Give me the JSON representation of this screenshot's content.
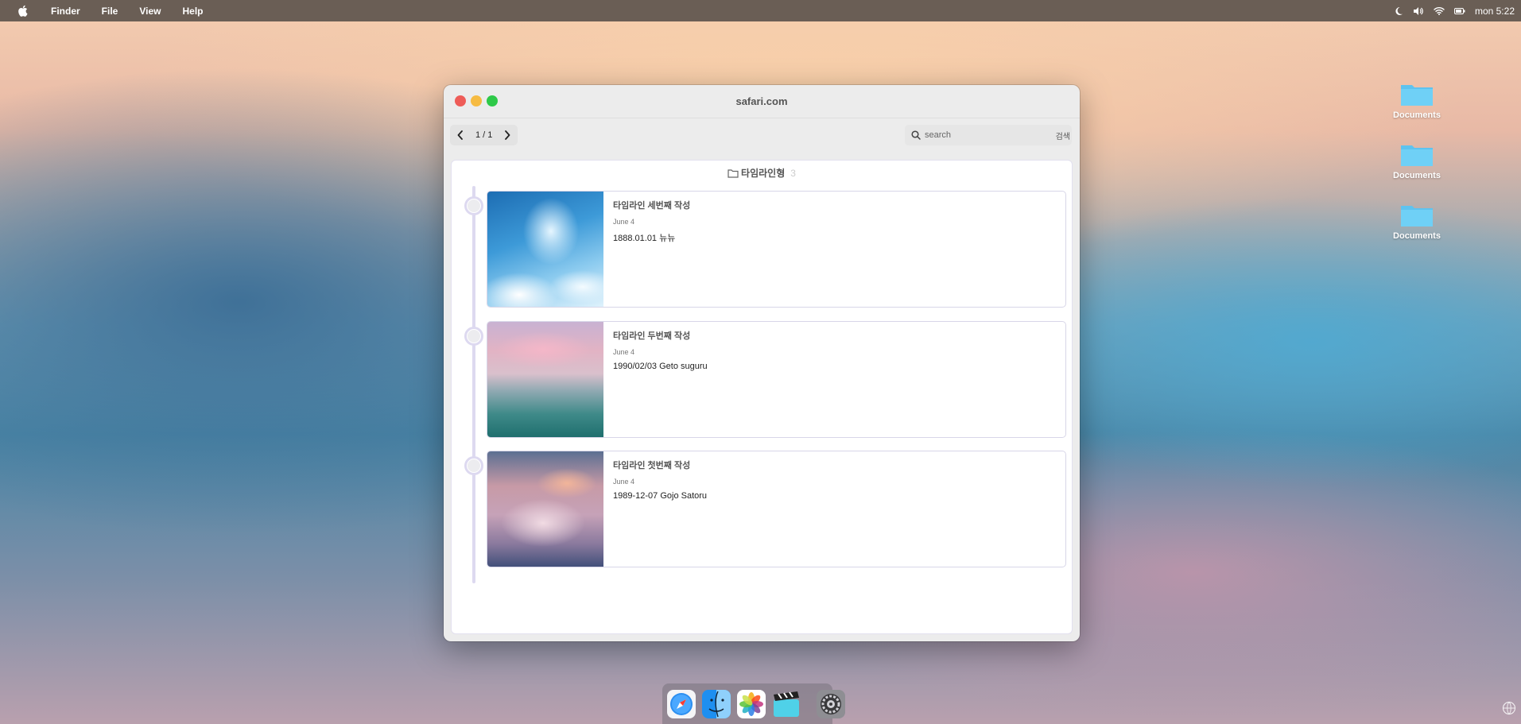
{
  "menubar": {
    "apple_icon": "apple-logo-icon",
    "items": [
      "Finder",
      "File",
      "View",
      "Help"
    ],
    "clock": "mon 5:22",
    "status_icons": [
      "moon-icon",
      "volume-icon",
      "wifi-icon",
      "battery-icon"
    ]
  },
  "desktop": {
    "icons": [
      {
        "label": "Documents",
        "icon": "folder-icon"
      },
      {
        "label": "Documents",
        "icon": "folder-icon"
      },
      {
        "label": "Documents",
        "icon": "folder-icon"
      }
    ]
  },
  "window": {
    "title": "safari.com",
    "toolbar": {
      "page_indicator": "1 / 1",
      "search_placeholder": "search",
      "search_button": "검색"
    },
    "folder": {
      "name": "타임라인형",
      "count": "3"
    },
    "entries": [
      {
        "title": "타임라인 세번째 작성",
        "date": "June 4",
        "body": "1888.01.01 뉴뉴"
      },
      {
        "title": "타임라인 두번째 작성",
        "date": "June 4",
        "body": "1990/02/03 Geto suguru"
      },
      {
        "title": "타임라인 첫번째 작성",
        "date": "June 4",
        "body": "1989-12-07 Gojo Satoru"
      }
    ]
  },
  "dock": {
    "apps": [
      "safari-icon",
      "finder-icon",
      "photos-icon",
      "clips-icon",
      "system-settings-icon"
    ]
  },
  "colors": {
    "menubar": "#6a5e55",
    "close": "#ee5c58",
    "minimize": "#f6bb42",
    "maximize": "#2ec949",
    "timeline": "#ddd9f0",
    "folder": "#5ec3ef"
  }
}
